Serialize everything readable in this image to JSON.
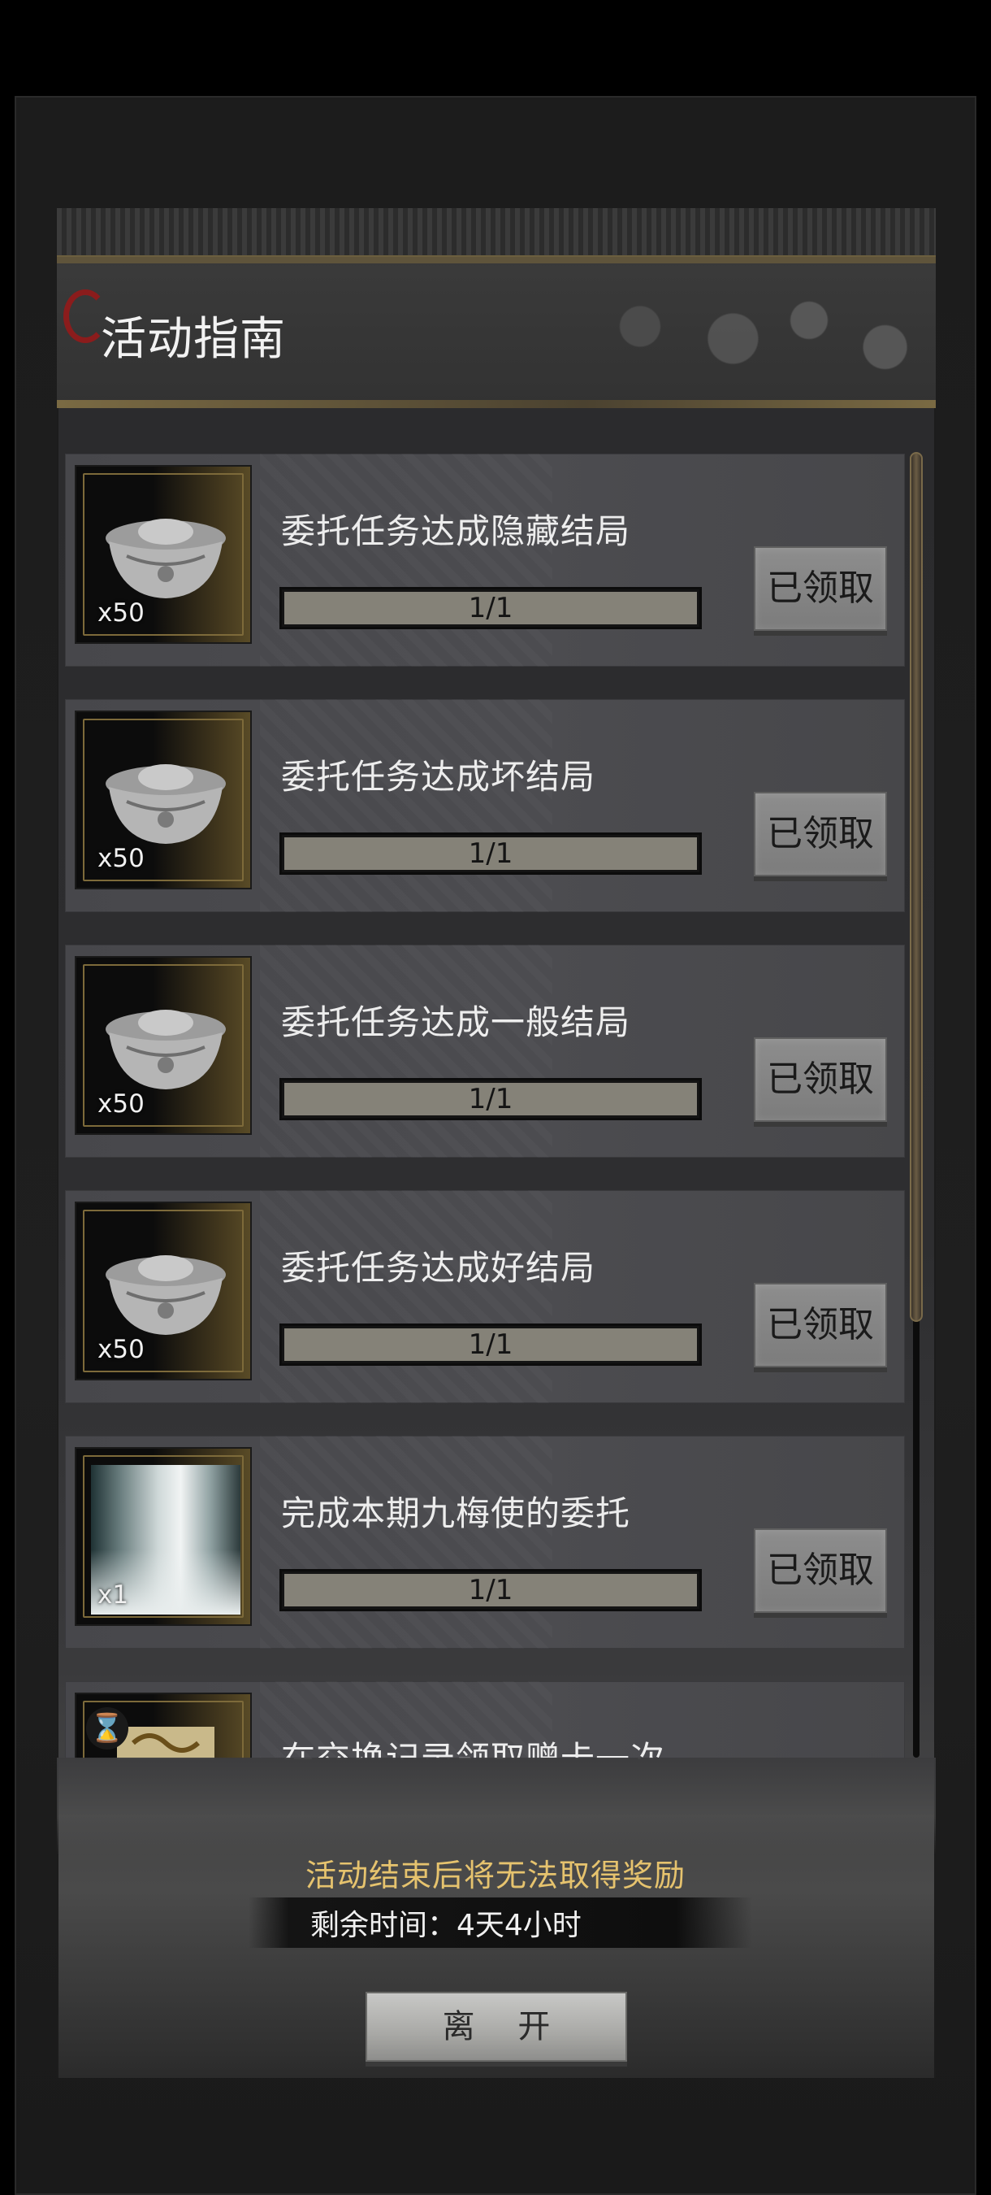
{
  "header": {
    "title": "活动指南"
  },
  "tasks": [
    {
      "title": "委托任务达成隐藏结局",
      "reward_qty": "x50",
      "reward_icon": "silver-ingot-icon",
      "progress_text": "1/1",
      "progress": 1.0,
      "button": "已领取"
    },
    {
      "title": "委托任务达成坏结局",
      "reward_qty": "x50",
      "reward_icon": "silver-ingot-icon",
      "progress_text": "1/1",
      "progress": 1.0,
      "button": "已领取"
    },
    {
      "title": "委托任务达成一般结局",
      "reward_qty": "x50",
      "reward_icon": "silver-ingot-icon",
      "progress_text": "1/1",
      "progress": 1.0,
      "button": "已领取"
    },
    {
      "title": "委托任务达成好结局",
      "reward_qty": "x50",
      "reward_icon": "silver-ingot-icon",
      "progress_text": "1/1",
      "progress": 1.0,
      "button": "已领取"
    },
    {
      "title": "完成本期九梅使的委托",
      "reward_qty": "x1",
      "reward_icon": "landscape-painting-icon",
      "progress_text": "1/1",
      "progress": 1.0,
      "button": "已领取"
    },
    {
      "title": "在交换记录领取赠卡一次",
      "reward_icon": "scroll-item-icon"
    }
  ],
  "footer": {
    "notice": "活动结束后将无法取得奖励",
    "remaining_time": "剩余时间：4天4小时",
    "leave_button": "离 开"
  },
  "colors": {
    "notice": "#e6c36e",
    "accent_red": "#8b1c1c",
    "progress_fill": "#858278"
  }
}
